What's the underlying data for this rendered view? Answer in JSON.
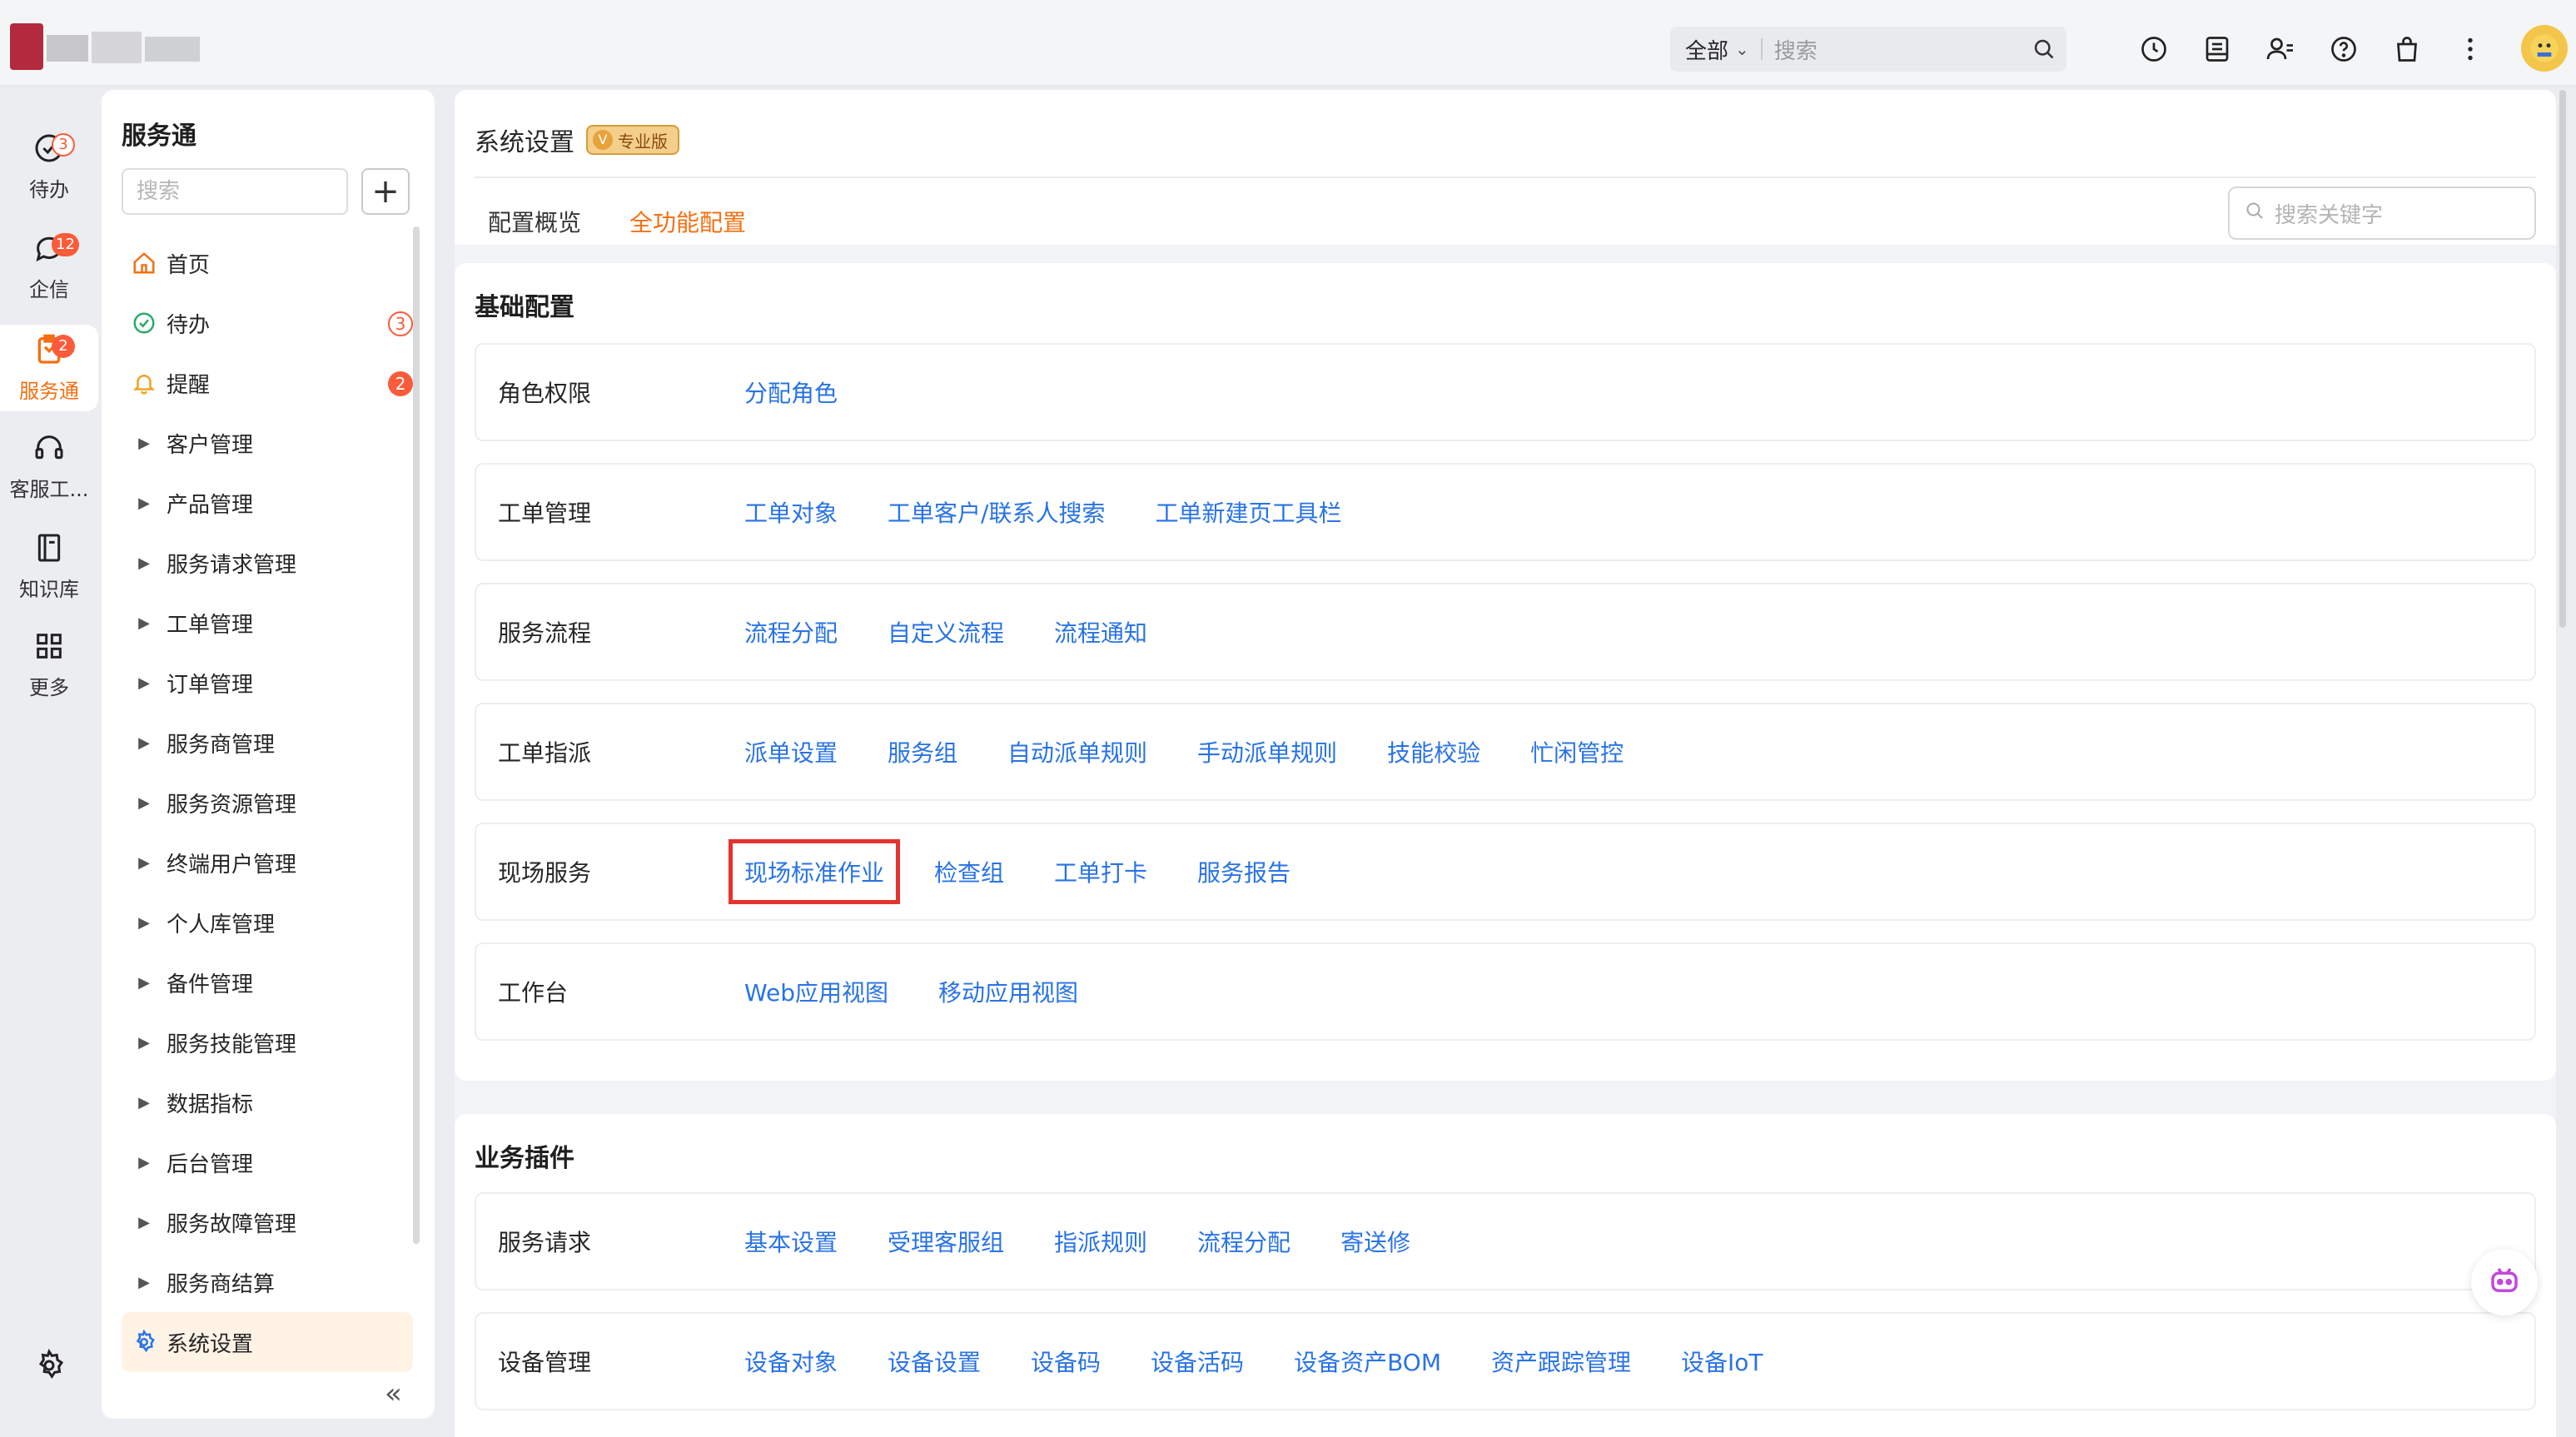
{
  "topbar": {
    "search_scope": "全部",
    "search_placeholder": "搜索",
    "icons": [
      "history-icon",
      "document-icon",
      "contacts-icon",
      "help-icon",
      "shop-icon",
      "more-icon"
    ]
  },
  "rail": {
    "items": [
      {
        "label": "待办",
        "badge": "3",
        "icon": "todo-check-icon",
        "active": false
      },
      {
        "label": "企信",
        "badge": "12",
        "icon": "chat-icon",
        "active": false
      },
      {
        "label": "服务通",
        "badge": "2",
        "icon": "service-icon",
        "active": true
      },
      {
        "label": "客服工...",
        "badge": "",
        "icon": "headset-icon",
        "active": false
      },
      {
        "label": "知识库",
        "badge": "",
        "icon": "book-icon",
        "active": false
      },
      {
        "label": "更多",
        "badge": "",
        "icon": "grid-icon",
        "active": false
      }
    ],
    "settings_icon": "gear-icon"
  },
  "sidebar": {
    "title": "服务通",
    "search_placeholder": "搜索",
    "items": [
      {
        "label": "首页",
        "icon": "home-icon"
      },
      {
        "label": "待办",
        "icon": "check-circle-icon",
        "badge": "3"
      },
      {
        "label": "提醒",
        "icon": "bell-icon",
        "badge": "2"
      },
      {
        "label": "客户管理"
      },
      {
        "label": "产品管理"
      },
      {
        "label": "服务请求管理"
      },
      {
        "label": "工单管理"
      },
      {
        "label": "订单管理"
      },
      {
        "label": "服务商管理"
      },
      {
        "label": "服务资源管理"
      },
      {
        "label": "终端用户管理"
      },
      {
        "label": "个人库管理"
      },
      {
        "label": "备件管理"
      },
      {
        "label": "服务技能管理"
      },
      {
        "label": "数据指标"
      },
      {
        "label": "后台管理"
      },
      {
        "label": "服务故障管理"
      },
      {
        "label": "服务商结算"
      },
      {
        "label": "系统设置",
        "icon": "gear-icon",
        "active": true
      }
    ]
  },
  "main": {
    "title": "系统设置",
    "badge": "专业版",
    "tabs": [
      {
        "label": "配置概览",
        "active": false
      },
      {
        "label": "全功能配置",
        "active": true
      }
    ],
    "keyword_placeholder": "搜索关键字",
    "sections": [
      {
        "title": "基础配置",
        "rows": [
          {
            "label": "角色权限",
            "links": [
              "分配角色"
            ]
          },
          {
            "label": "工单管理",
            "links": [
              "工单对象",
              "工单客户/联系人搜索",
              "工单新建页工具栏"
            ]
          },
          {
            "label": "服务流程",
            "links": [
              "流程分配",
              "自定义流程",
              "流程通知"
            ]
          },
          {
            "label": "工单指派",
            "links": [
              "派单设置",
              "服务组",
              "自动派单规则",
              "手动派单规则",
              "技能校验",
              "忙闲管控"
            ]
          },
          {
            "label": "现场服务",
            "links": [
              "现场标准作业",
              "检查组",
              "工单打卡",
              "服务报告"
            ],
            "highlight_index": 0
          },
          {
            "label": "工作台",
            "links": [
              "Web应用视图",
              "移动应用视图"
            ]
          }
        ]
      },
      {
        "title": "业务插件",
        "rows": [
          {
            "label": "服务请求",
            "links": [
              "基本设置",
              "受理客服组",
              "指派规则",
              "流程分配",
              "寄送修"
            ]
          },
          {
            "label": "设备管理",
            "links": [
              "设备对象",
              "设备设置",
              "设备码",
              "设备活码",
              "设备资产BOM",
              "资产跟踪管理",
              "设备IoT"
            ]
          }
        ]
      }
    ]
  },
  "colors": {
    "accent": "#f56f11",
    "link": "#2873e6",
    "badge": "#fb5b3a",
    "highlight": "#e5332f"
  }
}
